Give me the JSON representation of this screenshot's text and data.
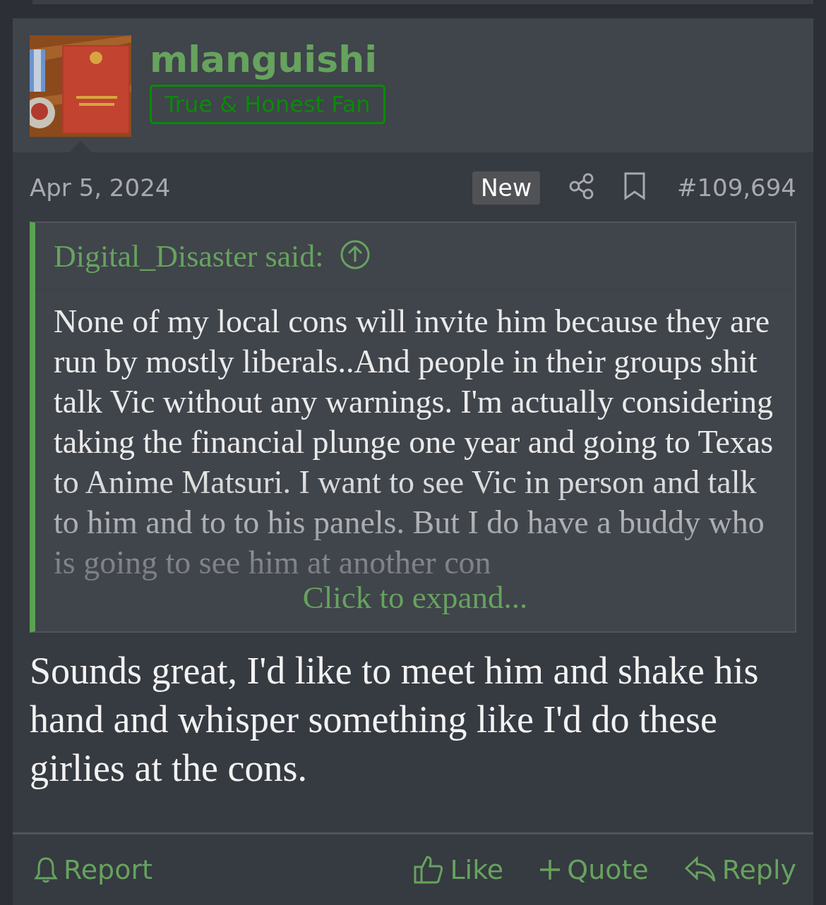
{
  "author": {
    "username": "mlanguishi",
    "user_title": "True & Honest Fan"
  },
  "post": {
    "date": "Apr 5, 2024",
    "new_badge": "New",
    "number": "#109,694",
    "quote": {
      "attribution": "Digital_Disaster said:",
      "text": "None of my local cons will invite him because they are run by mostly liberals..And people in their groups shit talk Vic without any warnings. I'm actually considering taking the financial plunge one year and going to Texas to Anime Matsuri. I want to see Vic in person and talk to him and to to his panels. But I do have a buddy who is going to see him at another con",
      "expand": "Click to expand..."
    },
    "body": "Sounds great, I'd like to meet him and shake his hand and whisper something like I'd do these girlies at the cons."
  },
  "actions": [
    {
      "kind": "report",
      "label": "Report"
    },
    {
      "kind": "like",
      "label": "Like"
    },
    {
      "kind": "quote",
      "label": "Quote"
    },
    {
      "kind": "reply",
      "label": "Reply"
    }
  ]
}
